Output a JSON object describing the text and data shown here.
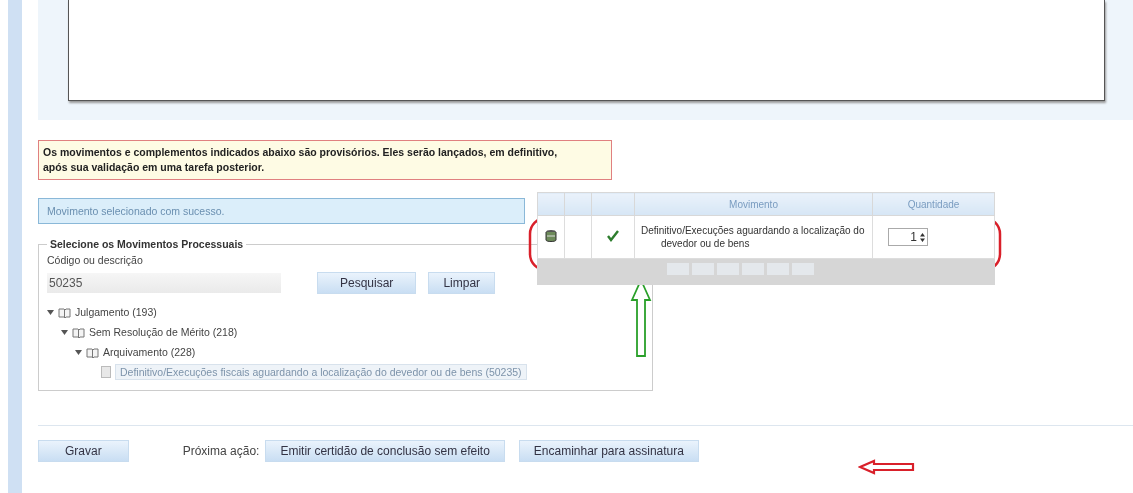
{
  "warning": "Os movimentos e complementos indicados abaixo são provisórios. Eles serão lançados, em definitivo, após sua validação em uma tarefa posterior.",
  "success": "Movimento selecionado com sucesso.",
  "selector": {
    "legend": "Selecione os Movimentos Processuais",
    "field_label": "Código ou descrição",
    "field_value": "50235",
    "buttons": [
      "Pesquisar",
      "Limpar"
    ],
    "tree": [
      {
        "label": "Julgamento (193)",
        "expanded": true,
        "children": [
          {
            "label": "Sem Resolução de Mérito (218)",
            "expanded": true,
            "children": [
              {
                "label": "Arquivamento (228)",
                "expanded": true,
                "children": [
                  {
                    "label": "Definitivo/Execuções fiscais aguardando a localização do devedor ou de bens (50235)",
                    "kind": "leaf",
                    "selected": true
                  }
                ]
              }
            ]
          }
        ]
      }
    ]
  },
  "table": {
    "columns": [
      "Movimento",
      "Quantidade"
    ],
    "rows": [
      {
        "validated": true,
        "movimento": "Definitivo/Execuções aguardando a localização do devedor ou de bens",
        "quantidade": "1"
      }
    ]
  },
  "footer": {
    "save": "Gravar",
    "next_label": "Próxima ação:",
    "actions": [
      "Emitir certidão de conclusão sem efeito",
      "Encaminhar para assinatura"
    ]
  }
}
